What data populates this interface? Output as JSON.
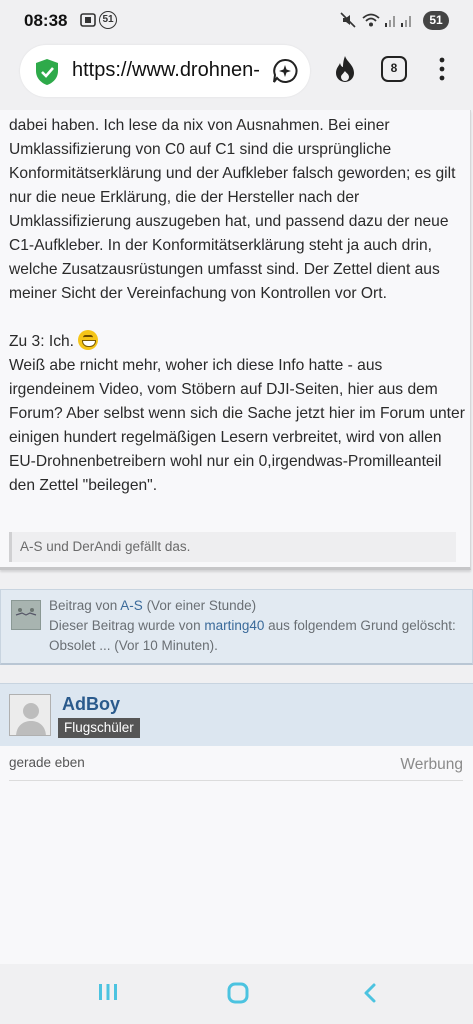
{
  "status_bar": {
    "time": "08:38",
    "notification_count": "51",
    "battery": "51",
    "icons": [
      "screenshot-icon",
      "notification-badge-icon",
      "mute-icon",
      "wifi-icon",
      "signal-icon",
      "signal-icon-2",
      "battery-icon"
    ]
  },
  "browser": {
    "url": "https://www.drohnen-",
    "tab_count": "8",
    "icons": [
      "shield-check-icon",
      "assistant-chat-icon",
      "flame-icon",
      "tabs-icon",
      "more-vert-icon"
    ]
  },
  "post": {
    "paragraphs": [
      "dabei haben. Ich lese da nix von Ausnahmen. Bei einer Umklassifizierung von C0 auf C1 sind die ursprüngliche Konformitätserklärung und der Aufkleber falsch geworden; es gilt nur die neue Erklärung, die der Hersteller nach der Umklassifizierung auszugeben hat, und passend dazu der neue C1-Aufkleber. In der Konformitätserklärung steht ja auch drin, welche Zusatzausrüstungen umfasst sind. Der Zettel dient aus meiner Sicht der Vereinfachung von Kontrollen vor Ort."
    ],
    "reply3_prefix": "Zu 3: Ich.",
    "reply3_body": "Weiß abe rnicht mehr, woher ich diese Info hatte - aus irgendeinem Video, vom Stöbern auf DJI-Seiten, hier aus dem Forum? Aber selbst wenn sich die Sache jetzt hier im Forum unter einigen hundert regelmäßigen Lesern verbreitet, wird von allen EU-Drohnenbetreibern wohl nur ein 0,irgendwas-Promilleanteil den Zettel \"beilegen\".",
    "likes": "A-S und DerAndi gefällt das."
  },
  "deleted_post": {
    "line1_prefix": "Beitrag von ",
    "author": "A-S",
    "line1_suffix": " (Vor einer Stunde)",
    "line2_prefix": "Dieser Beitrag wurde von ",
    "moderator": "marting40",
    "line2_suffix": " aus folgendem Grund gelöscht: Obsolet ... (Vor 10 Minuten)."
  },
  "next_post": {
    "author": "AdBoy",
    "rank": "Flugschüler",
    "time": "gerade eben",
    "ad_label": "Werbung"
  },
  "colors": {
    "link": "#2a5a8c",
    "header_bg": "#dce6f0",
    "nav_accent": "#4cc3e0",
    "shield_green": "#2eaa4a"
  }
}
